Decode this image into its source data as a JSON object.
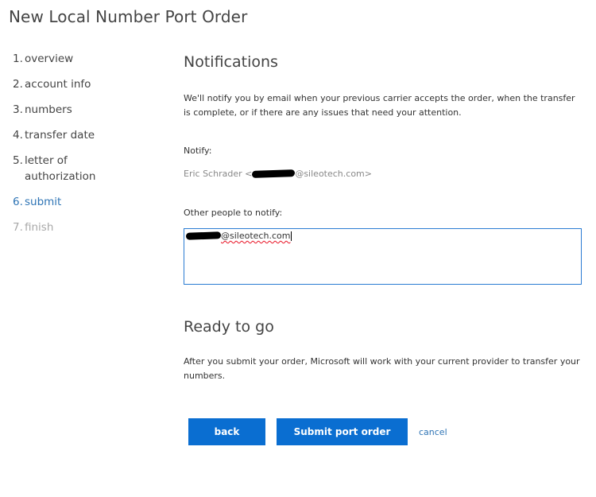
{
  "page": {
    "title": "New Local Number Port Order"
  },
  "steps": [
    {
      "num": "1.",
      "label": "overview",
      "state": "normal"
    },
    {
      "num": "2.",
      "label": "account info",
      "state": "normal"
    },
    {
      "num": "3.",
      "label": "numbers",
      "state": "normal"
    },
    {
      "num": "4.",
      "label": "transfer date",
      "state": "normal"
    },
    {
      "num": "5.",
      "label": "letter of authorization",
      "state": "normal"
    },
    {
      "num": "6.",
      "label": "submit",
      "state": "active"
    },
    {
      "num": "7.",
      "label": "finish",
      "state": "disabled"
    }
  ],
  "notifications": {
    "heading": "Notifications",
    "description": "We'll notify you by email when your previous carrier accepts the order, when the transfer is complete, or if there are any issues that need your attention.",
    "notify_label": "Notify:",
    "notify_name_prefix": "Eric Schrader <",
    "notify_domain_suffix": "@sileotech.com>",
    "other_label": "Other people to notify:",
    "other_domain": "@sileotech.com"
  },
  "ready": {
    "heading": "Ready to go",
    "description": "After you submit your order, Microsoft will work with your current provider to transfer your numbers."
  },
  "actions": {
    "back_label": "back",
    "submit_label": "Submit port order",
    "cancel_label": "cancel"
  },
  "colors": {
    "accent": "#0a6ed1",
    "link": "#2e74b5",
    "disabled": "#a8a8a8",
    "input_border": "#2b7cd3"
  }
}
